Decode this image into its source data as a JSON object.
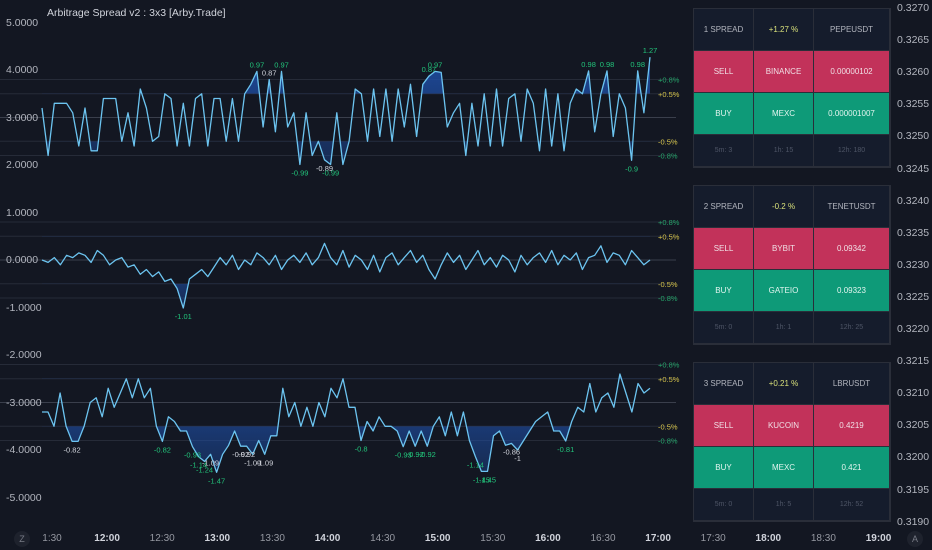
{
  "title": "Arbitrage Spread v2 : 3x3 [Arby.Trade]",
  "colors": {
    "bg": "#131722",
    "line": "#6cc4f0",
    "fill": "#1e4fa8",
    "sell": "#c2325a",
    "buy": "#0e9a78",
    "label_green": "#22c37a",
    "label_white": "#d1d4dc",
    "level_green": "#26a269",
    "level_yellow": "#d4c24a"
  },
  "chart_data": {
    "type": "line",
    "left_axis": {
      "ticks": [
        5,
        4,
        3,
        2,
        1,
        0,
        -1,
        -2,
        -3,
        -4,
        -5
      ],
      "labels": [
        "5.0000",
        "4.0000",
        "3.0000",
        "2.0000",
        "1.0000",
        "0.0000",
        "-1.0000",
        "-2.0000",
        "-3.0000",
        "-4.0000",
        "-5.0000"
      ]
    },
    "right_axis": {
      "labels": [
        "0.3270",
        "0.3265",
        "0.3260",
        "0.3255",
        "0.3250",
        "0.3245",
        "0.3240",
        "0.3235",
        "0.3230",
        "0.3225",
        "0.3220",
        "0.3215",
        "0.3210",
        "0.3205",
        "0.3200",
        "0.3195",
        "0.3190"
      ]
    },
    "x_axis": {
      "labels": [
        "1:30",
        "12:00",
        "12:30",
        "13:00",
        "13:30",
        "14:00",
        "14:30",
        "15:00",
        "15:30",
        "16:00",
        "16:30",
        "17:00",
        "17:30",
        "18:00",
        "18:30",
        "19:00"
      ],
      "major": [
        "12:00",
        "13:00",
        "14:00",
        "15:00",
        "16:00",
        "17:00",
        "18:00",
        "19:00"
      ],
      "left_button": "Z",
      "right_button": "A"
    },
    "levels": [
      {
        "value": 0.8,
        "label": "+0.8%",
        "tone": "green"
      },
      {
        "value": 0.5,
        "label": "+0.5%",
        "tone": "yellow"
      },
      {
        "value": -0.5,
        "label": "-0.5%",
        "tone": "yellow"
      },
      {
        "value": -0.8,
        "label": "-0.8%",
        "tone": "green"
      }
    ],
    "series": [
      {
        "name": "1 SPREAD",
        "offset": 3,
        "values": [
          0.2,
          -0.8,
          0.3,
          0.3,
          0.3,
          0.1,
          -0.6,
          0.2,
          -0.7,
          -0.7,
          0.4,
          0.4,
          0.4,
          -0.5,
          0.1,
          -0.6,
          0.6,
          0.2,
          -0.5,
          -0.4,
          0.5,
          0.4,
          -0.6,
          0.3,
          -0.6,
          0.4,
          0.5,
          -0.6,
          0.4,
          0.4,
          -0.5,
          0.4,
          -0.5,
          0.5,
          0.7,
          0.97,
          -0.2,
          0.8,
          -0.3,
          0.97,
          -0.2,
          0.1,
          -0.99,
          0.1,
          -0.8,
          -0.5,
          -0.89,
          -0.99,
          0.1,
          -0.99,
          -0.5,
          0.6,
          0.5,
          -0.5,
          0.6,
          -0.4,
          0.6,
          -0.5,
          0.6,
          -0.2,
          0.7,
          -0.4,
          0.7,
          0.87,
          0.97,
          0.95,
          -0.2,
          0.1,
          0.3,
          -0.8,
          0.3,
          -0.6,
          0.5,
          -0.6,
          0.6,
          -0.6,
          0.4,
          0.5,
          -0.5,
          0.6,
          0.3,
          -0.7,
          0.6,
          -0.6,
          0.5,
          -0.7,
          0.3,
          0.6,
          0.5,
          0.98,
          -0.3,
          0.5,
          0.98,
          -0.4,
          0.5,
          0.2,
          -0.9,
          0.98,
          0.1,
          1.27
        ],
        "annotations": [
          {
            "i": 35,
            "text": "0.97",
            "tone": "green"
          },
          {
            "i": 37,
            "text": "0.87",
            "tone": "white"
          },
          {
            "i": 39,
            "text": "0.97",
            "tone": "green"
          },
          {
            "i": 42,
            "text": "-0.99",
            "tone": "green"
          },
          {
            "i": 46,
            "text": "-0.89",
            "tone": "white"
          },
          {
            "i": 47,
            "text": "-0.99",
            "tone": "green"
          },
          {
            "i": 63,
            "text": "0.87",
            "tone": "green"
          },
          {
            "i": 64,
            "text": "0.97",
            "tone": "green"
          },
          {
            "i": 89,
            "text": "0.98",
            "tone": "green"
          },
          {
            "i": 92,
            "text": "0.98",
            "tone": "green"
          },
          {
            "i": 96,
            "text": "-0.9",
            "tone": "green"
          },
          {
            "i": 97,
            "text": "0.98",
            "tone": "green"
          },
          {
            "i": 99,
            "text": "1.27",
            "tone": "green"
          }
        ]
      },
      {
        "name": "2 SPREAD",
        "offset": 0,
        "values": [
          0,
          -0.05,
          0.05,
          -0.1,
          0.1,
          0.05,
          0.15,
          0.1,
          -0.05,
          0.2,
          0.1,
          -0.1,
          0.0,
          0.05,
          -0.15,
          -0.1,
          -0.3,
          -0.2,
          -0.35,
          -0.25,
          -0.45,
          -0.4,
          -0.6,
          -1.01,
          -0.4,
          -0.3,
          -0.2,
          -0.35,
          -0.15,
          0.05,
          -0.1,
          0.1,
          -0.2,
          0.0,
          -0.1,
          0.15,
          0.05,
          -0.1,
          0.1,
          -0.2,
          0.0,
          0.1,
          -0.05,
          0.15,
          -0.1,
          0.05,
          0.35,
          0.05,
          -0.1,
          0.2,
          -0.15,
          0.1,
          0.0,
          -0.2,
          0.1,
          -0.25,
          0.05,
          0.15,
          -0.1,
          0.05,
          0.2,
          -0.05,
          0.1,
          -0.2,
          -0.4,
          -0.1,
          0.15,
          -0.05,
          0.1,
          -0.2,
          0.0,
          0.2,
          -0.1,
          0.05,
          -0.15,
          0.1,
          0.0,
          -0.25,
          0.1,
          -0.1,
          0.05,
          0.15,
          -0.05,
          0.2,
          -0.1,
          0.1,
          0.0,
          0.15,
          -0.2,
          0.05,
          0.1,
          0.3,
          -0.05,
          0.15,
          0.1,
          -0.1,
          0.2,
          0.05,
          -0.1,
          0.0
        ],
        "annotations": [
          {
            "i": 23,
            "text": "-1.01",
            "tone": "green"
          }
        ]
      },
      {
        "name": "3 SPREAD",
        "offset": -3,
        "values": [
          -0.2,
          -0.2,
          -0.5,
          0.2,
          -0.5,
          -0.82,
          -0.82,
          -0.5,
          0.0,
          0.1,
          -0.3,
          0.3,
          -0.1,
          0.2,
          0.5,
          0.1,
          0.5,
          0.1,
          0.3,
          -0.5,
          -0.82,
          -0.3,
          -0.4,
          -0.6,
          -0.6,
          -0.93,
          -1.14,
          -1.24,
          -1.09,
          -1.47,
          -1.09,
          -0.9,
          -0.6,
          -0.92,
          -0.92,
          -1.09,
          -0.8,
          -1.09,
          -0.7,
          -0.7,
          0.3,
          -0.3,
          0.0,
          -0.5,
          -0.1,
          -0.5,
          0.0,
          -0.3,
          0.3,
          0.1,
          0.5,
          -0.1,
          -0.1,
          -0.8,
          -0.4,
          -0.6,
          -0.3,
          -0.5,
          -0.5,
          -0.6,
          -0.93,
          -0.6,
          -0.92,
          -0.6,
          -0.92,
          -0.5,
          -0.3,
          -0.7,
          -0.2,
          -0.7,
          -0.2,
          -0.8,
          -1.14,
          -1.45,
          -1.45,
          -0.7,
          -0.6,
          -0.9,
          -0.86,
          -1.0,
          -0.8,
          -0.6,
          -0.4,
          -0.3,
          -0.2,
          -0.6,
          -0.6,
          -0.81,
          -0.4,
          -0.1,
          -0.2,
          0.4,
          -0.2,
          0.1,
          0.2,
          -0.1,
          0.6,
          0.2,
          -0.2,
          0.4,
          0.2,
          0.3
        ],
        "annotations": [
          {
            "i": 5,
            "text": "-0.82",
            "tone": "white"
          },
          {
            "i": 20,
            "text": "-0.82",
            "tone": "green"
          },
          {
            "i": 25,
            "text": "-0.93",
            "tone": "green"
          },
          {
            "i": 26,
            "text": "-1.14",
            "tone": "green"
          },
          {
            "i": 27,
            "text": "-1.24",
            "tone": "green"
          },
          {
            "i": 28,
            "text": "-1.09",
            "tone": "white"
          },
          {
            "i": 29,
            "text": "-1.47",
            "tone": "green"
          },
          {
            "i": 33,
            "text": "-0.92",
            "tone": "white"
          },
          {
            "i": 34,
            "text": "-0.92",
            "tone": "white"
          },
          {
            "i": 35,
            "text": "-1.09",
            "tone": "white"
          },
          {
            "i": 37,
            "text": "-1.09",
            "tone": "white"
          },
          {
            "i": 53,
            "text": "-0.8",
            "tone": "green"
          },
          {
            "i": 60,
            "text": "-0.93",
            "tone": "green"
          },
          {
            "i": 62,
            "text": "-0.92",
            "tone": "green"
          },
          {
            "i": 64,
            "text": "-0.92",
            "tone": "green"
          },
          {
            "i": 72,
            "text": "-1.14",
            "tone": "green"
          },
          {
            "i": 73,
            "text": "-1.45",
            "tone": "green"
          },
          {
            "i": 74,
            "text": "-1.45",
            "tone": "green"
          },
          {
            "i": 78,
            "text": "-0.86",
            "tone": "white"
          },
          {
            "i": 79,
            "text": "-1",
            "tone": "white"
          },
          {
            "i": 87,
            "text": "-0.81",
            "tone": "green"
          }
        ]
      }
    ]
  },
  "tables": [
    {
      "spread": "1 SPREAD",
      "pct": "+1.27 %",
      "pair": "PEPEUSDT",
      "sell": {
        "label": "SELL",
        "exchange": "BINANCE",
        "price": "0.00000102"
      },
      "buy": {
        "label": "BUY",
        "exchange": "MEXC",
        "price": "0.000001007"
      },
      "stats": [
        "5m: 3",
        "1h: 15",
        "12h: 180"
      ]
    },
    {
      "spread": "2 SPREAD",
      "pct": "-0.2 %",
      "pair": "TENETUSDT",
      "sell": {
        "label": "SELL",
        "exchange": "BYBIT",
        "price": "0.09342"
      },
      "buy": {
        "label": "BUY",
        "exchange": "GATEIO",
        "price": "0.09323"
      },
      "stats": [
        "5m: 0",
        "1h: 1",
        "12h: 25"
      ]
    },
    {
      "spread": "3 SPREAD",
      "pct": "+0.21 %",
      "pair": "LBRUSDT",
      "sell": {
        "label": "SELL",
        "exchange": "KUCOIN",
        "price": "0.4219"
      },
      "buy": {
        "label": "BUY",
        "exchange": "MEXC",
        "price": "0.421"
      },
      "stats": [
        "5m: 0",
        "1h: 5",
        "12h: 52"
      ]
    }
  ]
}
